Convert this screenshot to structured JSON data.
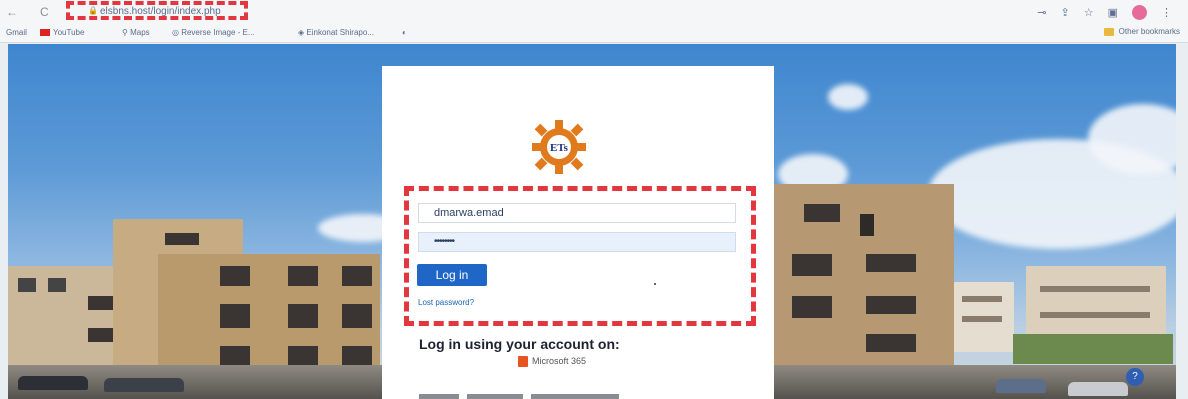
{
  "browser": {
    "back": "←",
    "reload": "C",
    "url": "elsbns.host/login/index.php",
    "bookmarks": [
      "Gmail",
      "YouTube",
      "Maps",
      "Reverse Image - E...",
      "Einkonat Shirapo..."
    ],
    "other_bookmarks": "Other bookmarks"
  },
  "login": {
    "username_value": "dmarwa.emad",
    "password_value": "••••••••",
    "login_button": "Log in",
    "lost_password": "Lost password?",
    "alt_login_title": "Log in using your account on:",
    "ms_label": "Microsoft 365"
  },
  "colors": {
    "highlight": "#e3373f",
    "primary_button": "#1f66c7",
    "link": "#1a62b8"
  },
  "icons": [
    "back-icon",
    "reload-icon",
    "lock-icon",
    "key-icon",
    "share-icon",
    "star-icon",
    "window-icon",
    "profile-avatar",
    "menu-icon",
    "site-logo",
    "microsoft-icon",
    "help-icon"
  ]
}
